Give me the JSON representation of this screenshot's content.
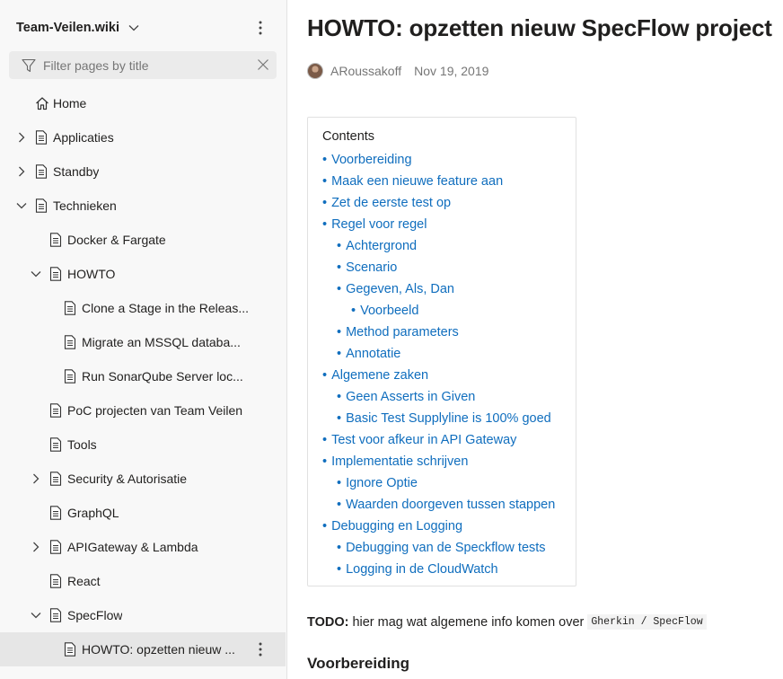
{
  "sidebar": {
    "wiki_name": "Team-Veilen.wiki",
    "filter_placeholder": "Filter pages by title",
    "items": [
      {
        "label": "Home",
        "icon": "home-icon"
      },
      {
        "label": "Applicaties",
        "expander": "collapsed"
      },
      {
        "label": "Standby",
        "expander": "collapsed"
      },
      {
        "label": "Technieken",
        "expander": "expanded"
      },
      {
        "label": "Docker & Fargate"
      },
      {
        "label": "HOWTO",
        "expander": "expanded"
      },
      {
        "label": "Clone a Stage in the Releas..."
      },
      {
        "label": "Migrate an MSSQL databa..."
      },
      {
        "label": "Run SonarQube Server loc..."
      },
      {
        "label": "PoC projecten van Team Veilen"
      },
      {
        "label": "Tools"
      },
      {
        "label": "Security & Autorisatie",
        "expander": "collapsed"
      },
      {
        "label": "GraphQL"
      },
      {
        "label": "APIGateway & Lambda",
        "expander": "collapsed"
      },
      {
        "label": "React"
      },
      {
        "label": "SpecFlow",
        "expander": "expanded"
      },
      {
        "label": "HOWTO: opzetten nieuw ...",
        "selected": true
      }
    ]
  },
  "page": {
    "title": "HOWTO: opzetten nieuw SpecFlow project",
    "author": "ARoussakoff",
    "date": "Nov 19, 2019",
    "toc_title": "Contents",
    "toc": [
      {
        "text": "Voorbereiding",
        "level": 0
      },
      {
        "text": "Maak een nieuwe feature aan",
        "level": 0
      },
      {
        "text": "Zet de eerste test op",
        "level": 0
      },
      {
        "text": "Regel voor regel",
        "level": 0
      },
      {
        "text": "Achtergrond",
        "level": 1
      },
      {
        "text": "Scenario",
        "level": 1
      },
      {
        "text": "Gegeven, Als, Dan",
        "level": 1
      },
      {
        "text": "Voorbeeld",
        "level": 2
      },
      {
        "text": "Method parameters",
        "level": 1
      },
      {
        "text": "Annotatie",
        "level": 1
      },
      {
        "text": "Algemene zaken",
        "level": 0
      },
      {
        "text": "Geen Asserts in Given",
        "level": 1
      },
      {
        "text": "Basic Test Supplyline is 100% goed",
        "level": 1
      },
      {
        "text": "Test voor afkeur in API Gateway",
        "level": 0
      },
      {
        "text": "Implementatie schrijven",
        "level": 0
      },
      {
        "text": "Ignore Optie",
        "level": 1
      },
      {
        "text": "Waarden doorgeven tussen stappen",
        "level": 1
      },
      {
        "text": "Debugging en Logging",
        "level": 0
      },
      {
        "text": "Debugging van de Speckflow tests",
        "level": 1
      },
      {
        "text": "Logging in de CloudWatch",
        "level": 1
      }
    ],
    "todo_label": "TODO:",
    "todo_text": "hier mag wat algemene info komen over",
    "todo_code": "Gherkin / SpecFlow",
    "section_heading": "Voorbereiding"
  },
  "colors": {
    "link": "#106ebe",
    "sidebar_bg": "#f8f8f8",
    "selected_bg": "#e6e6e6"
  }
}
